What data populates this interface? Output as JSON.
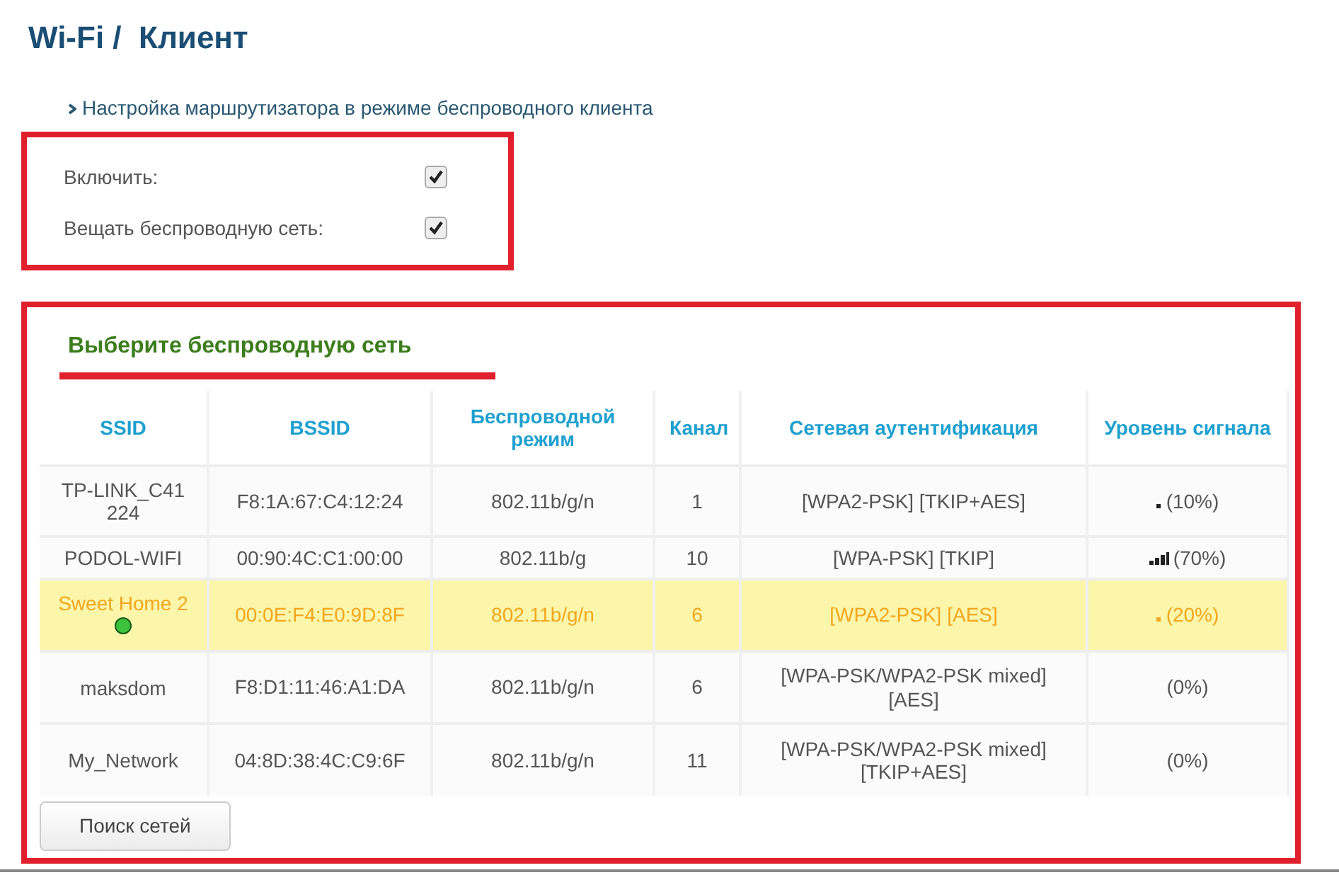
{
  "page": {
    "title": "Wi-Fi /  Клиент",
    "subtitle": "Настройка маршрутизатора в режиме беспроводного клиента"
  },
  "settings": [
    {
      "label": "Включить:",
      "checked": true
    },
    {
      "label": "Вещать беспроводную сеть:",
      "checked": true
    }
  ],
  "networks": {
    "heading": "Выберите беспроводную сеть",
    "columns": [
      "SSID",
      "BSSID",
      "Беспроводной режим",
      "Канал",
      "Сетевая аутентификация",
      "Уровень сигнала"
    ],
    "rows": [
      {
        "ssid": "TP-LINK_C41224",
        "bssid": "F8:1A:67:C4:12:24",
        "mode": "802.11b/g/n",
        "channel": "1",
        "auth": "[WPA2-PSK] [TKIP+AES]",
        "kind": "weak",
        "signal": "(10%)",
        "selected": false,
        "connected": false
      },
      {
        "ssid": "PODOL-WIFI",
        "bssid": "00:90:4C:C1:00:00",
        "mode": "802.11b/g",
        "channel": "10",
        "auth": "[WPA-PSK] [TKIP]",
        "kind": "fair",
        "signal": "(70%)",
        "selected": false,
        "connected": false
      },
      {
        "ssid": "Sweet Home 2",
        "bssid": "00:0E:F4:E0:9D:8F",
        "mode": "802.11b/g/n",
        "channel": "6",
        "auth": "[WPA2-PSK] [AES]",
        "kind": "weak",
        "signal": "(20%)",
        "selected": true,
        "connected": true
      },
      {
        "ssid": "maksdom",
        "bssid": "F8:D1:11:46:A1:DA",
        "mode": "802.11b/g/n",
        "channel": "6",
        "auth": "[WPA-PSK/WPA2-PSK mixed] [AES]",
        "kind": "none",
        "signal": "(0%)",
        "selected": false,
        "connected": false
      },
      {
        "ssid": "My_Network",
        "bssid": "04:8D:38:4C:C9:6F",
        "mode": "802.11b/g/n",
        "channel": "11",
        "auth": "[WPA-PSK/WPA2-PSK mixed] [TKIP+AES]",
        "kind": "none",
        "signal": "(0%)",
        "selected": false,
        "connected": false
      }
    ],
    "button": "Поиск сетей"
  }
}
